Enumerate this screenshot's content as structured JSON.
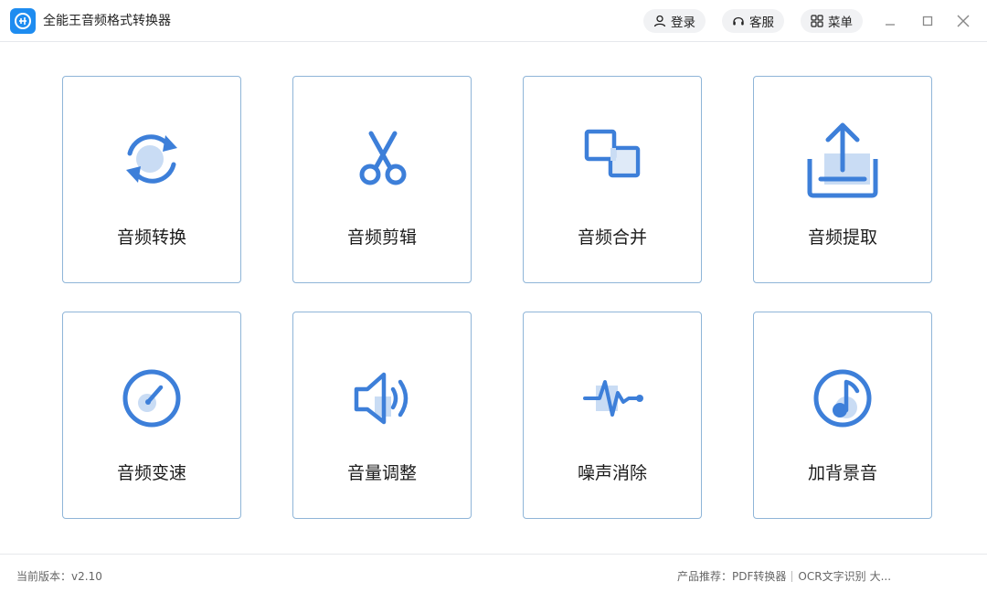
{
  "app": {
    "title": "全能王音频格式转换器"
  },
  "header": {
    "login_label": "登录",
    "service_label": "客服",
    "menu_label": "菜单"
  },
  "tools": [
    {
      "label": "音频转换",
      "icon": "audio-convert-icon"
    },
    {
      "label": "音频剪辑",
      "icon": "scissors-icon"
    },
    {
      "label": "音频合并",
      "icon": "merge-icon"
    },
    {
      "label": "音频提取",
      "icon": "extract-upload-icon"
    },
    {
      "label": "音频变速",
      "icon": "speed-dial-icon"
    },
    {
      "label": "音量调整",
      "icon": "volume-icon"
    },
    {
      "label": "噪声消除",
      "icon": "pulse-wave-icon"
    },
    {
      "label": "加背景音",
      "icon": "music-note-icon"
    }
  ],
  "footer": {
    "version_label": "当前版本：",
    "version_value": "v2.10",
    "recommend_label": "产品推荐：",
    "recommend_links": [
      "PDF转换器",
      "OCR文字识别",
      "大..."
    ]
  },
  "colors": {
    "accent": "#3d7fd9",
    "accent_light": "#c9dcf4",
    "card_border": "#8fb5d8"
  }
}
